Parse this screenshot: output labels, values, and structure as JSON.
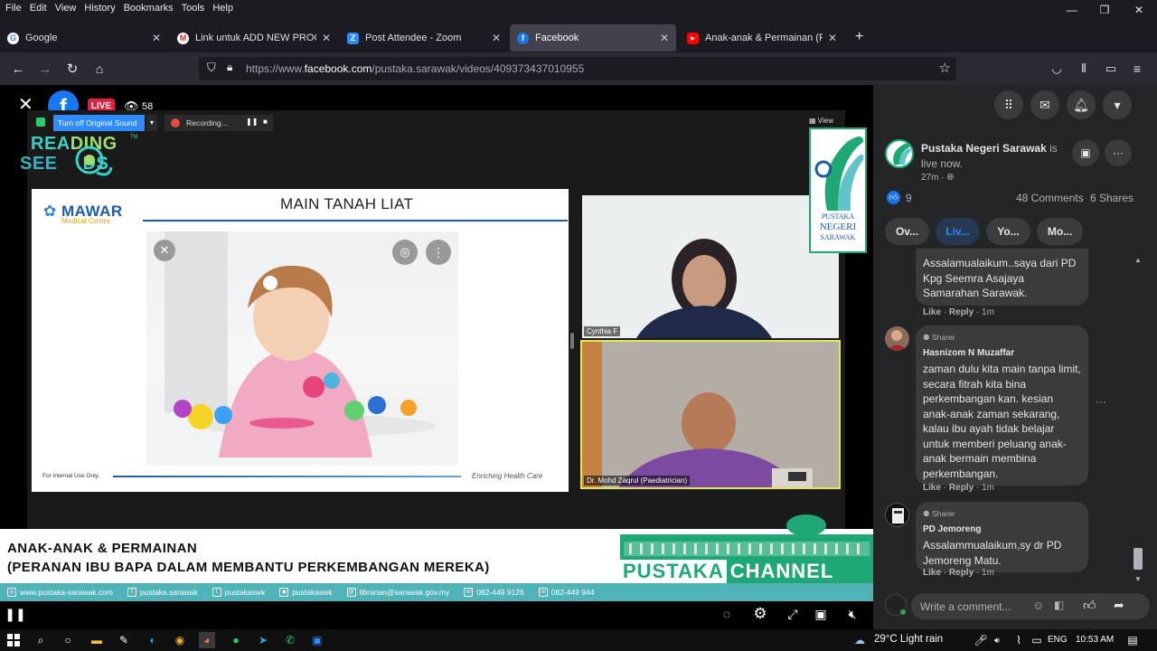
{
  "menu": [
    "File",
    "Edit",
    "View",
    "History",
    "Bookmarks",
    "Tools",
    "Help"
  ],
  "window": {
    "minimize": "—",
    "restore": "❐",
    "close": "✕"
  },
  "tabs": [
    {
      "title": "Google",
      "fav": "G",
      "color": "#4285f4"
    },
    {
      "title": "Link untuk ADD NEW PROGRAM",
      "fav": "M",
      "color": "#d93025"
    },
    {
      "title": "Post Attendee - Zoom",
      "fav": "Z",
      "color": "#2d8cff"
    },
    {
      "title": "Facebook",
      "fav": "f",
      "color": "#1877f2"
    },
    {
      "title": "Anak-anak & Permainan (Perana",
      "fav": "▶",
      "color": "#ff0000"
    }
  ],
  "newtab": "+",
  "url": {
    "prefix": "https://www.",
    "domain": "facebook.com",
    "path": "/pustaka.sarawak/videos/409373437010955"
  },
  "video": {
    "live": "LIVE",
    "viewers": "58",
    "original_sound": "Turn off Original Sound",
    "recording": "Recording...",
    "view_label": "View",
    "logo_text": [
      "REA",
      "DING",
      "SEE",
      "DS",
      "TM"
    ],
    "slide": {
      "title": "MAIN TANAH LIAT",
      "brand": "MAWAR",
      "brand_sub": "Medical Centre",
      "footer_left": "For Internal Use Only.",
      "footer_right": "Enriching Health Care"
    },
    "cam1_label": "Cynthia F",
    "cam2_label": "Dr. Mohd Zaqrul (Paediatrician)",
    "pustaka_logo": [
      "PUSTAKA",
      "NEGERI",
      "SARAWAK"
    ],
    "banner_line1": "ANAK-ANAK & PERMAINAN",
    "banner_line2": "(PERANAN IBU BAPA DALAM  MEMBANTU PERKEMBANGAN MEREKA)",
    "channel": [
      "PUSTAKA",
      "CHANNEL"
    ],
    "contacts": [
      "www.pustaka-sarawak.com",
      "pustaka.sarawak",
      "pustakaswk",
      "pustakaswk",
      "librarian@sarawak.gov.my",
      "082-449 9126",
      "082-449 944"
    ]
  },
  "fb": {
    "page": "Pustaka Negeri Sarawak",
    "status": " is live now.",
    "time": "27m · ",
    "reactions": "9",
    "comments": "48 Comments",
    "shares": "6 Shares",
    "pills": [
      "Ov...",
      "Liv...",
      "Yo...",
      "Mo..."
    ],
    "c1": {
      "text": "Assalamualaikum..saya dari PD Kpg Seemra Asajaya Samarahan Sarawak.",
      "like": "Like",
      "reply": "Reply",
      "time": "1m"
    },
    "c2": {
      "role": "Sharer",
      "name": "Hasnizom N Muzaffar",
      "text": "zaman dulu kita main tanpa limit, secara fitrah kita bina perkembangan kan. kesian anak-anak zaman sekarang, kalau ibu ayah tidak belajar untuk memberi peluang anak-anak bermain membina perkembangan.",
      "like": "Like",
      "reply": "Reply",
      "time": "1m"
    },
    "c3": {
      "role": "Sharer",
      "name": "PD Jemoreng",
      "text": "Assalammualaikum,sy dr PD Jemoreng Matu.",
      "like": "Like",
      "reply": "Reply",
      "time": "1m"
    },
    "composer_placeholder": "Write a comment...",
    "more": "···"
  },
  "taskbar": {
    "weather": "29°C  Light rain",
    "lang": "ENG",
    "clock": "10:53 AM"
  },
  "colors": {
    "fb_blue": "#1877f2",
    "live_red": "#e41e3f",
    "pustaka_green": "#1fa874",
    "contact_teal": "#4fb3b8"
  }
}
